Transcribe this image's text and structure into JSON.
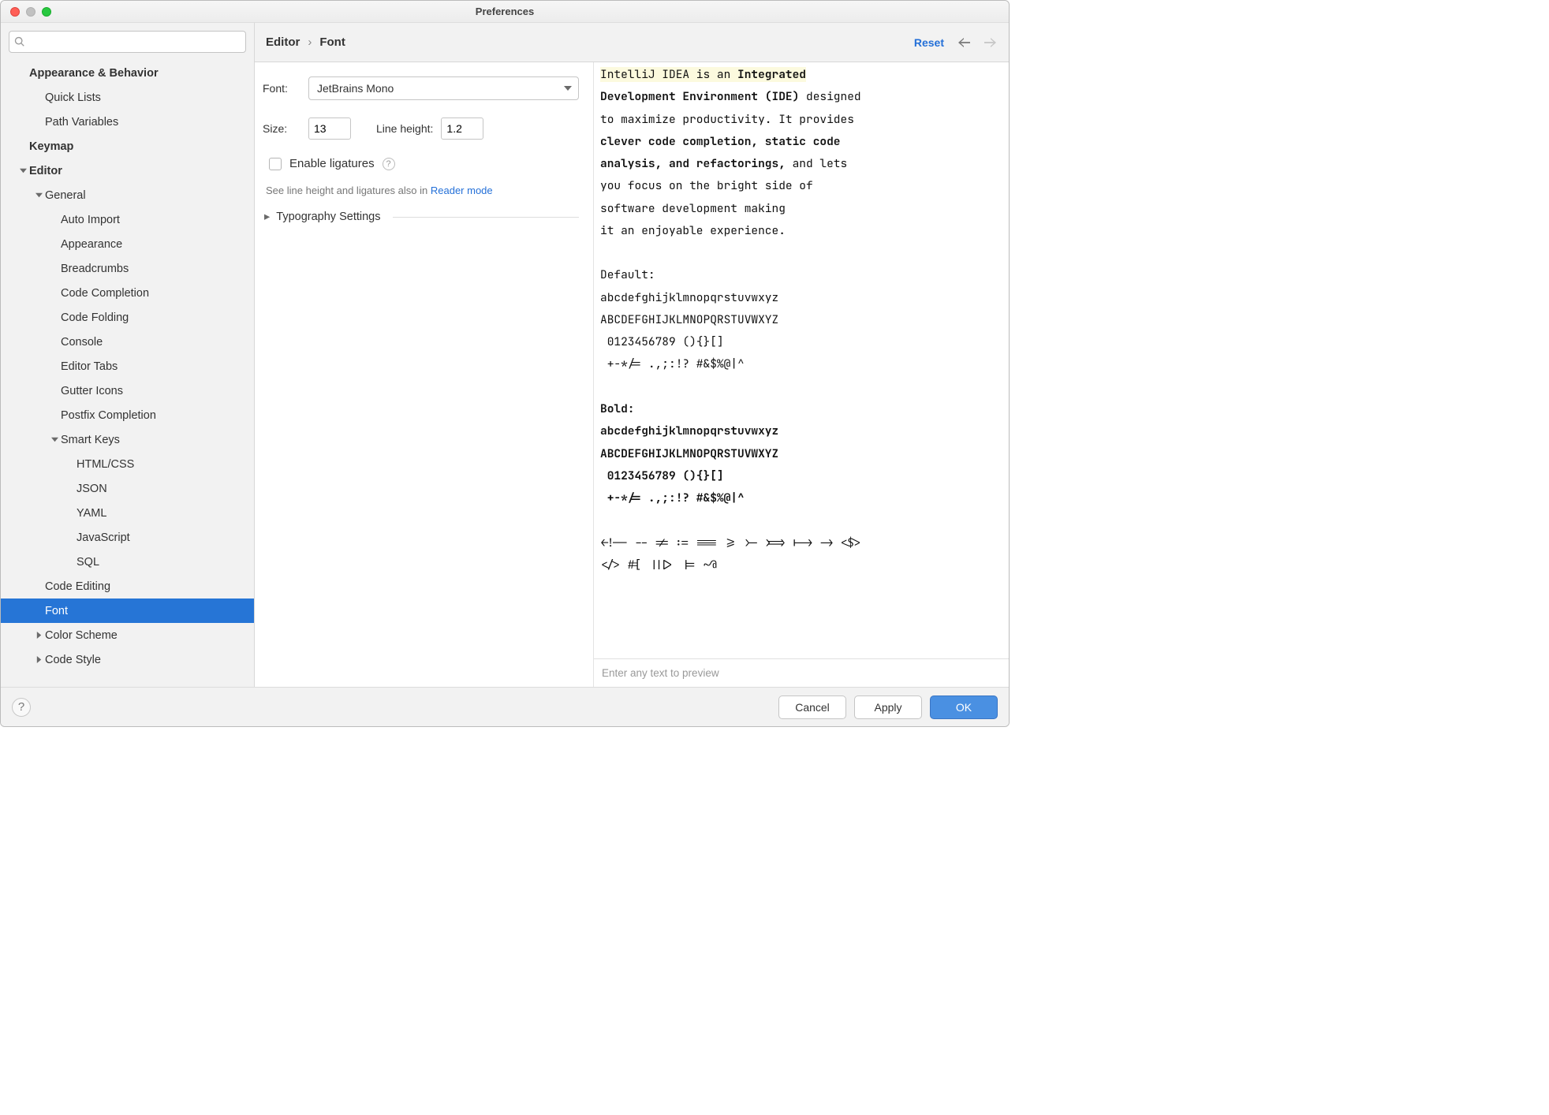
{
  "window": {
    "title": "Preferences"
  },
  "search": {
    "placeholder": ""
  },
  "tree": [
    {
      "label": "Appearance & Behavior",
      "depth": 0,
      "bold": true,
      "arrow": "none"
    },
    {
      "label": "Quick Lists",
      "depth": 1,
      "arrow": "none"
    },
    {
      "label": "Path Variables",
      "depth": 1,
      "arrow": "none"
    },
    {
      "label": "Keymap",
      "depth": 0,
      "bold": true,
      "arrow": "none"
    },
    {
      "label": "Editor",
      "depth": 0,
      "bold": true,
      "arrow": "down"
    },
    {
      "label": "General",
      "depth": 1,
      "arrow": "down"
    },
    {
      "label": "Auto Import",
      "depth": 2,
      "arrow": "none"
    },
    {
      "label": "Appearance",
      "depth": 2,
      "arrow": "none"
    },
    {
      "label": "Breadcrumbs",
      "depth": 2,
      "arrow": "none"
    },
    {
      "label": "Code Completion",
      "depth": 2,
      "arrow": "none"
    },
    {
      "label": "Code Folding",
      "depth": 2,
      "arrow": "none"
    },
    {
      "label": "Console",
      "depth": 2,
      "arrow": "none"
    },
    {
      "label": "Editor Tabs",
      "depth": 2,
      "arrow": "none"
    },
    {
      "label": "Gutter Icons",
      "depth": 2,
      "arrow": "none"
    },
    {
      "label": "Postfix Completion",
      "depth": 2,
      "arrow": "none"
    },
    {
      "label": "Smart Keys",
      "depth": 2,
      "arrow": "down"
    },
    {
      "label": "HTML/CSS",
      "depth": 3,
      "arrow": "none"
    },
    {
      "label": "JSON",
      "depth": 3,
      "arrow": "none"
    },
    {
      "label": "YAML",
      "depth": 3,
      "arrow": "none"
    },
    {
      "label": "JavaScript",
      "depth": 3,
      "arrow": "none"
    },
    {
      "label": "SQL",
      "depth": 3,
      "arrow": "none"
    },
    {
      "label": "Code Editing",
      "depth": 1,
      "arrow": "none"
    },
    {
      "label": "Font",
      "depth": 1,
      "arrow": "none",
      "selected": true
    },
    {
      "label": "Color Scheme",
      "depth": 1,
      "arrow": "right"
    },
    {
      "label": "Code Style",
      "depth": 1,
      "arrow": "right"
    }
  ],
  "breadcrumb": {
    "parent": "Editor",
    "current": "Font"
  },
  "header": {
    "reset": "Reset"
  },
  "form": {
    "font_label": "Font:",
    "font_value": "JetBrains Mono",
    "size_label": "Size:",
    "size_value": "13",
    "lineheight_label": "Line height:",
    "lineheight_value": "1.2",
    "ligatures_label": "Enable ligatures",
    "hint_prefix": "See line height and ligatures also in ",
    "hint_link": "Reader mode",
    "typography_label": "Typography Settings"
  },
  "preview": {
    "line1_a": "IntelliJ IDEA is an ",
    "line1_b": "Integrated",
    "line2_a": "Development Environment (IDE)",
    "line2_b": " designed",
    "line3": "to maximize productivity. It provides",
    "line4": "clever code completion, static code",
    "line5_a": "analysis, and refactorings,",
    "line5_b": " and lets",
    "line6": "you focus on the bright side of",
    "line7": "software development making",
    "line8": "it an enjoyable experience.",
    "default_heading": "Default:",
    "sample_lower": "abcdefghijklmnopqrstuvwxyz",
    "sample_upper": "ABCDEFGHIJKLMNOPQRSTUVWXYZ",
    "sample_nums": " 0123456789 (){}[]",
    "sample_syms": " +-*/= .,;:!? #&$%@|^",
    "bold_heading": "Bold:",
    "ligatures": "<!-- -- != := === >= >- >=> |-> -> <$>",
    "ligatures2": "</> #[ |||> |= ~@",
    "footer_placeholder": "Enter any text to preview"
  },
  "footer": {
    "cancel": "Cancel",
    "apply": "Apply",
    "ok": "OK"
  }
}
